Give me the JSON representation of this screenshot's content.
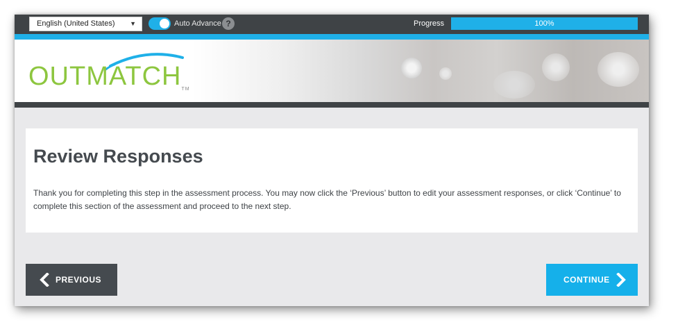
{
  "topbar": {
    "language": "English (United States)",
    "auto_advance_label": "Auto Advance",
    "auto_advance_on": true,
    "help_symbol": "?",
    "progress_label": "Progress",
    "progress_value": 100,
    "progress_text": "100%"
  },
  "banner": {
    "logo_text": "OUTMATCH",
    "logo_tm": "TM"
  },
  "content": {
    "title": "Review Responses",
    "body": "Thank you for completing this step in the assessment process. You may now click the ‘Previous’ button to edit your assessment responses, or click ‘Continue’ to complete this section of the assessment and proceed to the next step."
  },
  "buttons": {
    "previous": "PREVIOUS",
    "continue": "CONTINUE"
  },
  "icons": {
    "language_dropdown": "caret-down-icon",
    "help": "question-icon",
    "previous": "chevron-left-icon",
    "continue": "chevron-right-icon"
  },
  "colors": {
    "topbar": "#3f4346",
    "accent": "#1fb0e8",
    "logo_green": "#8dc63f",
    "prev_button": "#454a4f",
    "continue_button": "#15b0ea"
  }
}
